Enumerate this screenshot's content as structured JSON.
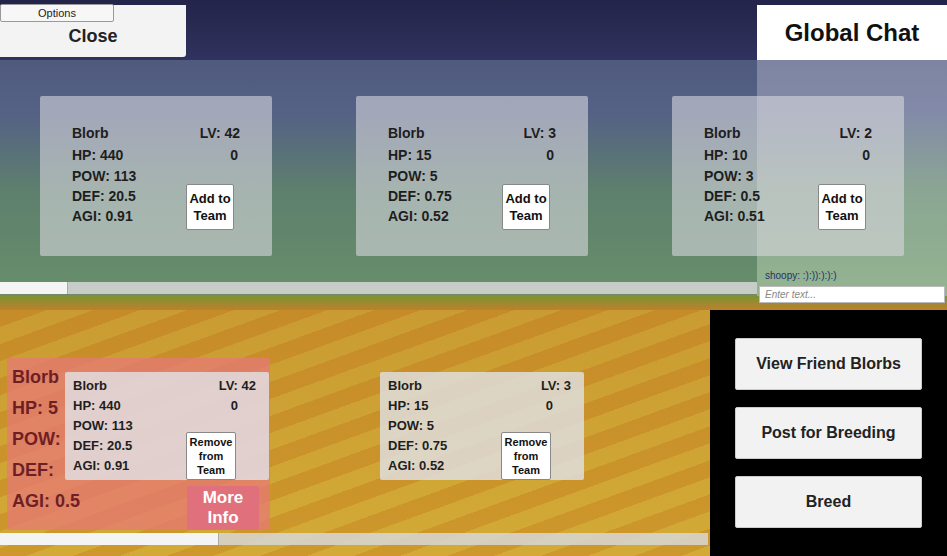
{
  "options_tab": {
    "label": "Options"
  },
  "close_button": {
    "label": "Close"
  },
  "chat": {
    "title": "Global Chat",
    "messages": [
      {
        "text": "shoopy: :):)):):):)"
      }
    ],
    "input": {
      "placeholder": "Enter text..."
    }
  },
  "available": {
    "cards": [
      {
        "name": "Blorb",
        "level": "LV: 42",
        "xp": "0",
        "stats": [
          "HP: 440",
          "POW: 113",
          "DEF: 20.5",
          "AGI: 0.91"
        ],
        "button": "Add to Team"
      },
      {
        "name": "Blorb",
        "level": "LV: 3",
        "xp": "0",
        "stats": [
          "HP: 15",
          "POW: 5",
          "DEF: 0.75",
          "AGI: 0.52"
        ],
        "button": "Add to Team"
      },
      {
        "name": "Blorb",
        "level": "LV: 2",
        "xp": "0",
        "stats": [
          "HP: 10",
          "POW: 3",
          "DEF: 0.5",
          "AGI: 0.51"
        ],
        "button": "Add to Team"
      }
    ],
    "scroll": {
      "level": 0.09
    }
  },
  "team": {
    "cards": [
      {
        "name": "Blorb",
        "level": "LV: 42",
        "xp": "0",
        "stats": [
          "HP: 440",
          "POW: 113",
          "DEF: 20.5",
          "AGI: 0.91"
        ],
        "button": "Remove from Team"
      },
      {
        "name": "Blorb",
        "level": "LV: 3",
        "xp": "0",
        "stats": [
          "HP: 15",
          "POW: 5",
          "DEF: 0.75",
          "AGI: 0.52"
        ],
        "button": "Remove from Team"
      }
    ],
    "scroll": {
      "level": 0.31
    }
  },
  "detail": {
    "name": "Blorb",
    "stats": [
      "HP: 5",
      "POW:",
      "DEF:",
      "AGI: 0.5"
    ],
    "button": "More Info"
  },
  "actions": [
    "View Friend Blorbs",
    "Post for Breeding",
    "Breed"
  ]
}
